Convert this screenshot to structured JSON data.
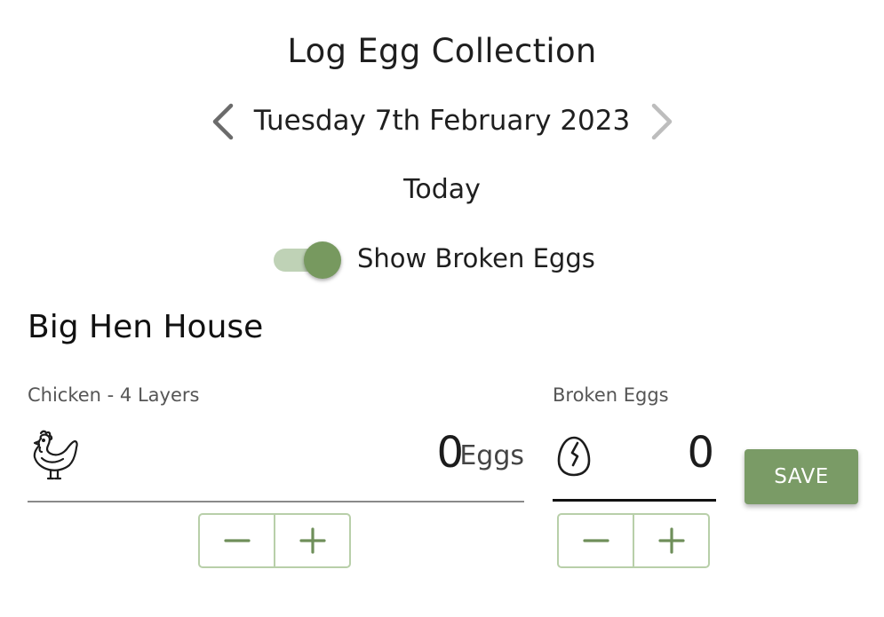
{
  "header": {
    "title": "Log Egg Collection",
    "date": "Tuesday 7th February 2023",
    "relative_day": "Today",
    "prev_icon": "chevron-left-icon",
    "next_icon": "chevron-right-icon"
  },
  "toggle": {
    "label": "Show Broken Eggs",
    "on": true
  },
  "house": {
    "name": "Big Hen House",
    "eggs": {
      "label": "Chicken - 4 Layers",
      "icon": "chicken-icon",
      "value": "0",
      "unit": "Eggs"
    },
    "broken": {
      "label": "Broken Eggs",
      "icon": "broken-egg-icon",
      "value": "0"
    },
    "stepper": {
      "minus_icon": "minus-icon",
      "plus_icon": "plus-icon"
    },
    "save_label": "SAVE"
  },
  "colors": {
    "accent": "#7a9b66",
    "toggle_track": "#bfd2b6",
    "stepper_border": "#b8cfa9",
    "chevron_active": "#6b6b6b",
    "chevron_disabled": "#bdbdbd"
  }
}
